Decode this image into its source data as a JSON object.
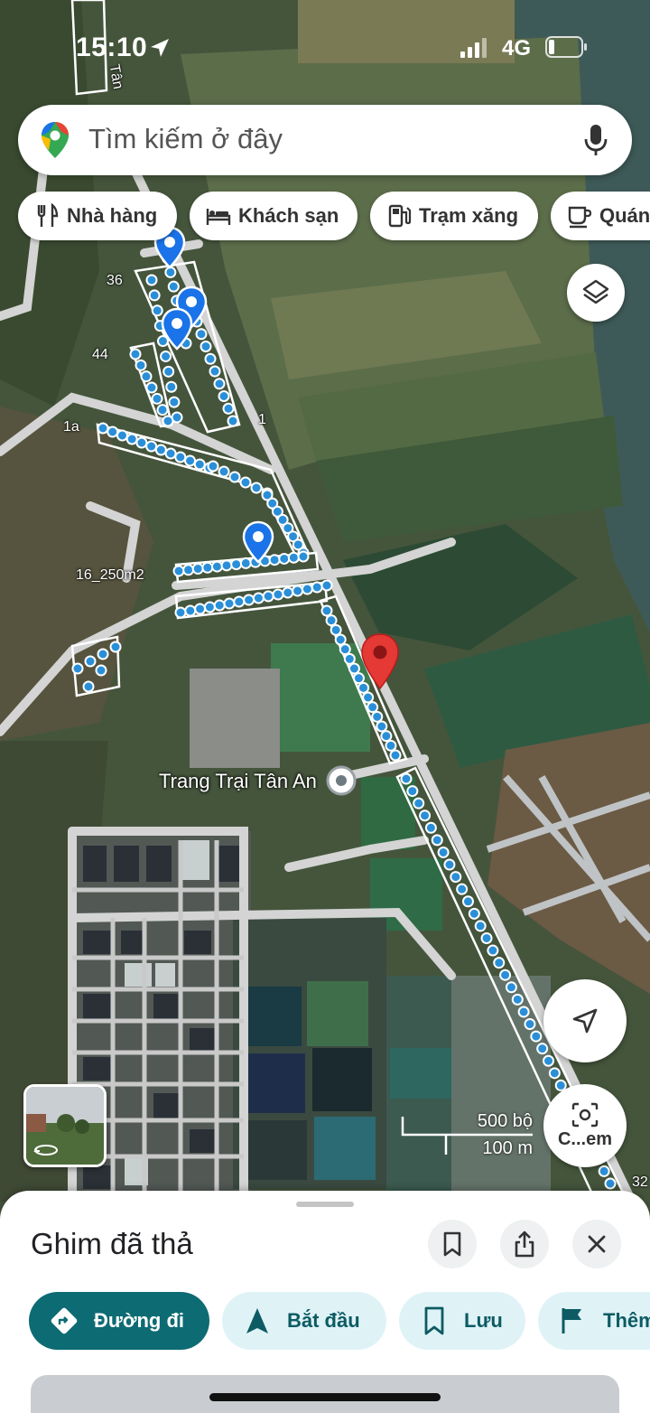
{
  "status_bar": {
    "time": "15:10",
    "network": "4G"
  },
  "search": {
    "placeholder": "Tìm kiếm ở đây"
  },
  "categories": [
    {
      "label": "Nhà hàng",
      "icon": "restaurant-icon"
    },
    {
      "label": "Khách sạn",
      "icon": "hotel-icon"
    },
    {
      "label": "Trạm xăng",
      "icon": "gas-station-icon"
    },
    {
      "label": "Quán",
      "icon": "cafe-icon"
    }
  ],
  "map": {
    "road_labels": [
      "Tân",
      "36",
      "44",
      "1a",
      "1",
      "16_250m2",
      "32"
    ],
    "place_label": "Trang Trại Tân An",
    "scale_imperial": "500 bộ",
    "scale_metric": "100 m",
    "camera_button_label": "C...em"
  },
  "sheet": {
    "title": "Ghim đã thả",
    "actions": [
      {
        "label": "Đường đi",
        "icon": "directions-icon"
      },
      {
        "label": "Bắt đầu",
        "icon": "navigation-start-icon"
      },
      {
        "label": "Lưu",
        "icon": "bookmark-icon"
      },
      {
        "label": "Thêm",
        "icon": "flag-icon"
      }
    ]
  },
  "colors": {
    "primary_action": "#0d6b73",
    "secondary_action": "#dff3f7",
    "pin_red": "#e53935",
    "pin_blue": "#1a73e8",
    "road": "#d9d9d9"
  }
}
